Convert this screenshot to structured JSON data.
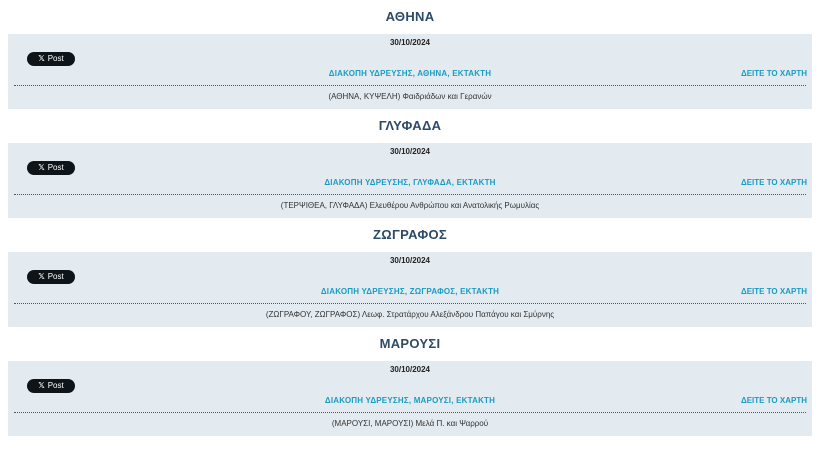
{
  "sections": [
    {
      "title": "ΑΘΗΝΑ",
      "date": "30/10/2024",
      "post_label": "Post",
      "headline": "ΔΙΑΚΟΠΗ ΥΔΡΕΥΣΗΣ, ΑΘΗΝΑ, ΕΚΤΑΚΤΗ",
      "map_link": "ΔΕΙΤΕ ΤΟ ΧΑΡΤΗ",
      "address": "(ΑΘΗΝΑ, ΚΥΨΕΛΗ) Φαιδριάδων και Γερανών"
    },
    {
      "title": "ΓΛΥΦΑΔΑ",
      "date": "30/10/2024",
      "post_label": "Post",
      "headline": "ΔΙΑΚΟΠΗ ΥΔΡΕΥΣΗΣ, ΓΛΥΦΑΔΑ, ΕΚΤΑΚΤΗ",
      "map_link": "ΔΕΙΤΕ ΤΟ ΧΑΡΤΗ",
      "address": "(ΤΕΡΨΙΘΕΑ, ΓΛΥΦΑΔΑ) Ελευθέρου Ανθρώπου και Ανατολικής Ρωμυλίας"
    },
    {
      "title": "ΖΩΓΡΑΦΟΣ",
      "date": "30/10/2024",
      "post_label": "Post",
      "headline": "ΔΙΑΚΟΠΗ ΥΔΡΕΥΣΗΣ, ΖΩΓΡΑΦΟΣ, ΕΚΤΑΚΤΗ",
      "map_link": "ΔΕΙΤΕ ΤΟ ΧΑΡΤΗ",
      "address": "(ΖΩΓΡΑΦΟΥ, ΖΩΓΡΑΦΟΣ) Λεωφ. Στρατάρχου Αλεξάνδρου Παπάγου και Σμύρνης"
    },
    {
      "title": "ΜΑΡΟΥΣΙ",
      "date": "30/10/2024",
      "post_label": "Post",
      "headline": "ΔΙΑΚΟΠΗ ΥΔΡΕΥΣΗΣ, ΜΑΡΟΥΣΙ, ΕΚΤΑΚΤΗ",
      "map_link": "ΔΕΙΤΕ ΤΟ ΧΑΡΤΗ",
      "address": "(ΜΑΡΟΥΣΙ, ΜΑΡΟΥΣΙ) Μελά Π. και Ψαρρού"
    }
  ],
  "colors": {
    "card_bg": "#e4ebf0",
    "link": "#1a9bc4",
    "title": "#2d4a66",
    "post_button": "#0f1419"
  },
  "icons": {
    "post_button": "x-logo-icon"
  }
}
